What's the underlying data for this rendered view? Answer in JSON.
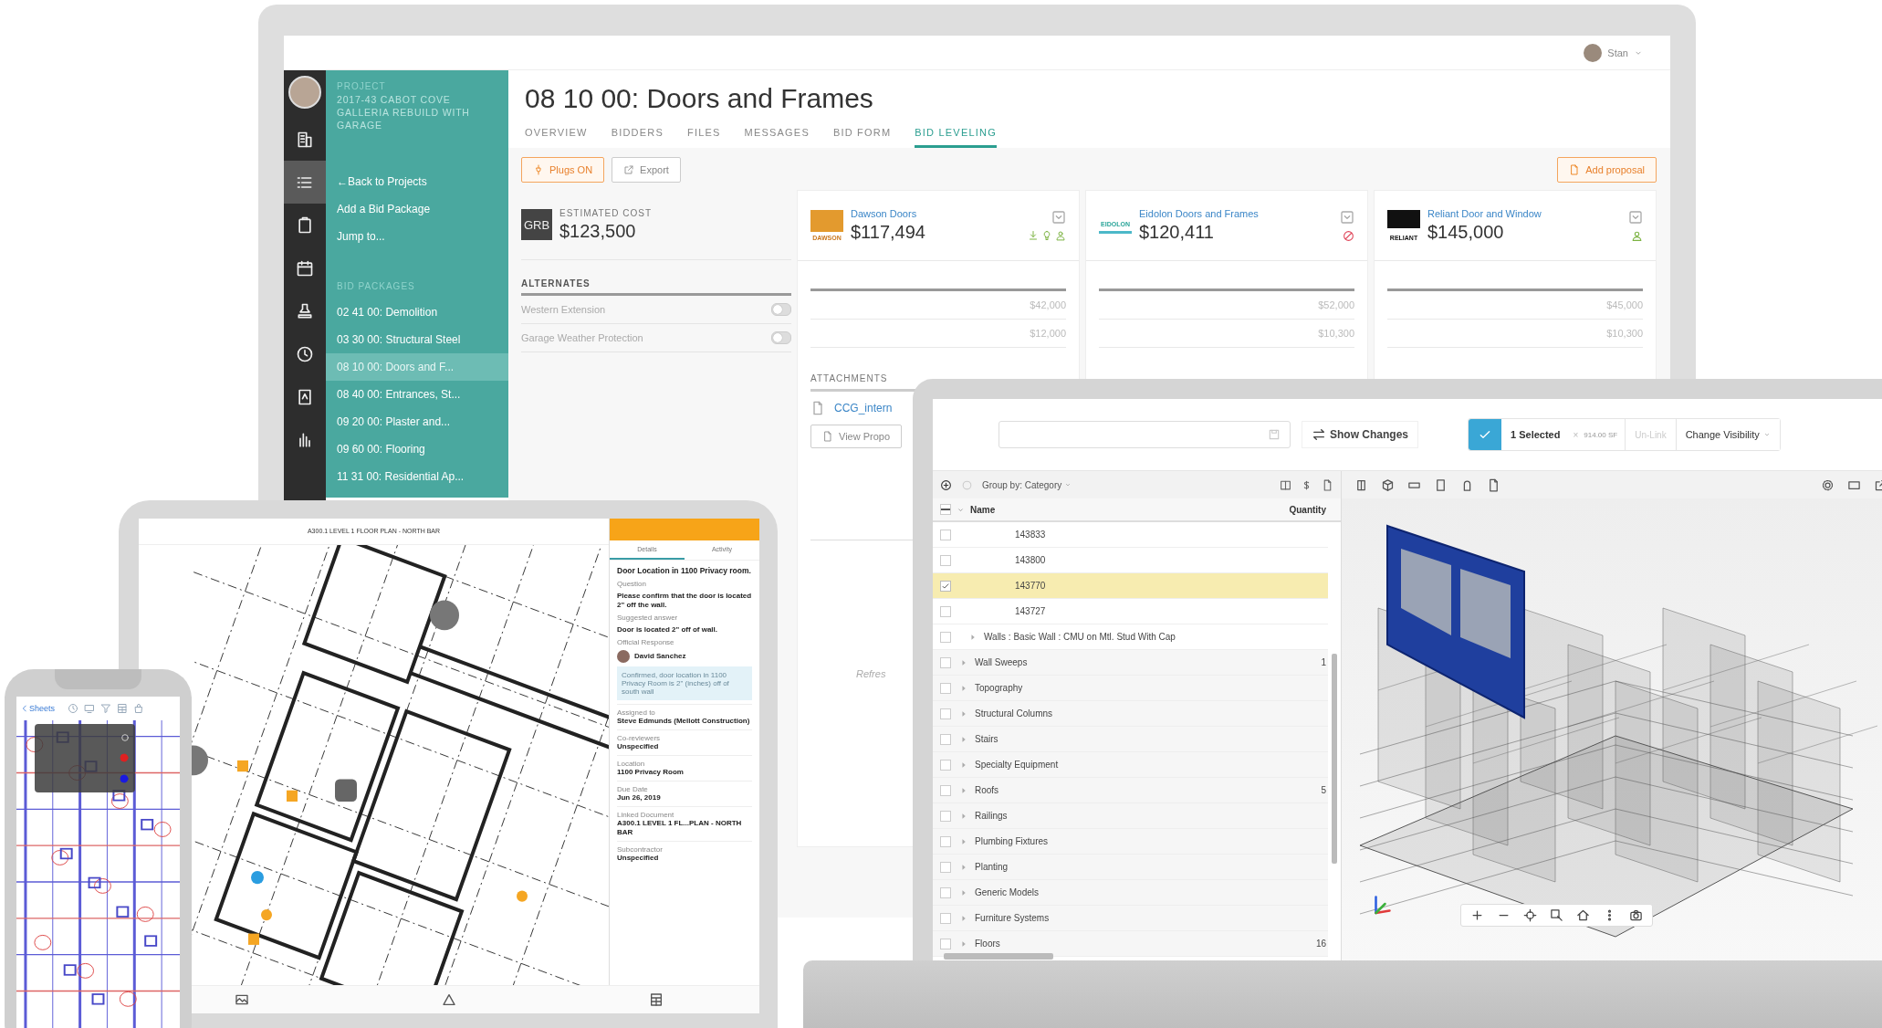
{
  "monitor": {
    "user": {
      "name": "Stan"
    },
    "rail": [
      {
        "kind": "building",
        "selected": false
      },
      {
        "kind": "list",
        "selected": true
      },
      {
        "kind": "clipboard",
        "selected": false
      },
      {
        "kind": "calendar",
        "selected": false
      },
      {
        "kind": "stamp",
        "selected": false
      },
      {
        "kind": "clock",
        "selected": false
      },
      {
        "kind": "book",
        "selected": false
      },
      {
        "kind": "chart",
        "selected": false
      }
    ],
    "sidebar": {
      "project_label": "PROJECT",
      "project_name": "2017-43 CABOT COVE GALLERIA REBUILD WITH GARAGE",
      "links": [
        "←Back to Projects",
        "Add a Bid Package",
        "Jump to..."
      ],
      "section_label": "BID PACKAGES",
      "packages": [
        {
          "label": "02 41 00: Demolition",
          "selected": false
        },
        {
          "label": "03 30 00: Structural Steel",
          "selected": false
        },
        {
          "label": "08 10 00: Doors and F...",
          "selected": true
        },
        {
          "label": "08 40 00: Entrances, St...",
          "selected": false
        },
        {
          "label": "09 20 00: Plaster and...",
          "selected": false
        },
        {
          "label": "09 60 00: Flooring",
          "selected": false
        },
        {
          "label": "11 31 00: Residential Ap...",
          "selected": false
        }
      ]
    },
    "page": {
      "title": "08 10 00: Doors and Frames",
      "tabs": [
        {
          "label": "OVERVIEW",
          "selected": false
        },
        {
          "label": "BIDDERS",
          "selected": false
        },
        {
          "label": "FILES",
          "selected": false
        },
        {
          "label": "MESSAGES",
          "selected": false
        },
        {
          "label": "BID FORM",
          "selected": false
        },
        {
          "label": "BID LEVELING",
          "selected": true
        }
      ],
      "actions": [
        {
          "kind": "plugs",
          "label": "Plugs ON"
        },
        {
          "kind": "export",
          "label": "Export"
        }
      ],
      "add_button": "Add proposal",
      "estimate": {
        "logo": "GRB",
        "label": "ESTIMATED COST",
        "amount": "$123,500"
      },
      "alternates": {
        "heading": "ALTERNATES",
        "rows": [
          {
            "label": "Western Extension",
            "on": false
          },
          {
            "label": "Garage Weather Protection",
            "on": false
          }
        ]
      },
      "bidders": [
        {
          "logo": "DAWSON",
          "name": "Dawson Doors",
          "amount": "$117,494",
          "kind": "submitted",
          "alternates": [
            "$42,000",
            "$12,000"
          ]
        },
        {
          "logo": "EIDOLON",
          "name": "Eidolon Doors and Frames",
          "amount": "$120,411",
          "kind": "declined",
          "alternates": [
            "$52,000",
            "$10,300"
          ]
        },
        {
          "logo": "RELIANT",
          "name": "Reliant Door and Window",
          "amount": "$145,000",
          "kind": "invited",
          "alternates": [
            "$45,000",
            "$10,300"
          ]
        }
      ],
      "attachments": {
        "heading": "ATTACHMENTS",
        "file": "CCG_intern",
        "button": "View Propo"
      },
      "refresh": "Refres"
    }
  },
  "laptop": {
    "show_changes": "Show Changes",
    "selection": {
      "count": "1 Selected",
      "clear": "×",
      "area": "914.00 SF",
      "unlink": "Un-Link",
      "unlink_disabled": true,
      "visibility": "Change Visibility"
    },
    "group_by": "Group by: Category",
    "select_all": {
      "partial": true
    },
    "columns": [
      "Name",
      "Quantity"
    ],
    "rows": [
      {
        "kind": "element",
        "name": "143833",
        "checked": false,
        "selected": false
      },
      {
        "kind": "element",
        "name": "143800",
        "checked": false,
        "selected": false
      },
      {
        "kind": "element",
        "name": "143770",
        "checked": true,
        "selected": true
      },
      {
        "kind": "element",
        "name": "143727",
        "checked": false,
        "selected": false
      },
      {
        "kind": "type",
        "name": "Walls : Basic Wall : CMU on Mtl. Stud With Cap",
        "checked": false,
        "selected": false
      },
      {
        "kind": "category",
        "name": "Wall Sweeps",
        "quantity": "1",
        "checked": false,
        "selected": false
      },
      {
        "kind": "category",
        "name": "Topography",
        "checked": false,
        "selected": false
      },
      {
        "kind": "category",
        "name": "Structural Columns",
        "checked": false,
        "selected": false
      },
      {
        "kind": "category",
        "name": "Stairs",
        "checked": false,
        "selected": false
      },
      {
        "kind": "category",
        "name": "Specialty Equipment",
        "checked": false,
        "selected": false
      },
      {
        "kind": "category",
        "name": "Roofs",
        "quantity": "5",
        "checked": false,
        "selected": false
      },
      {
        "kind": "category",
        "name": "Railings",
        "checked": false,
        "selected": false
      },
      {
        "kind": "category",
        "name": "Plumbing Fixtures",
        "checked": false,
        "selected": false
      },
      {
        "kind": "category",
        "name": "Planting",
        "checked": false,
        "selected": false
      },
      {
        "kind": "category",
        "name": "Generic Models",
        "checked": false,
        "selected": false
      },
      {
        "kind": "category",
        "name": "Furniture Systems",
        "checked": false,
        "selected": false
      },
      {
        "kind": "category",
        "name": "Floors",
        "quantity": "16",
        "checked": false,
        "selected": false
      }
    ]
  },
  "tablet": {
    "sheet_title": "A300.1 LEVEL 1 FLOOR PLAN - NORTH BAR",
    "tabs": [
      {
        "label": "Details",
        "selected": true
      },
      {
        "label": "Activity",
        "selected": false
      }
    ],
    "heading": "Door Location in 1100 Privacy room.",
    "question": {
      "label": "Question",
      "value": "Please confirm that the door is located 2\" off the wall."
    },
    "suggested": {
      "label": "Suggested answer",
      "value": "Door is located 2\" off of wall."
    },
    "response": {
      "label": "Official Response",
      "author": "David Sanchez",
      "text": "Confirmed, door location in 1100 Privacy Room is 2\" (inches) off of south wall"
    },
    "fields": [
      {
        "label": "Assigned to",
        "value": "Steve Edmunds (Mellott Construction)"
      },
      {
        "label": "Co-reviewers",
        "value": "Unspecified"
      },
      {
        "label": "Location",
        "value": "1100 Privacy Room"
      },
      {
        "label": "Due Date",
        "value": "Jun 26, 2019"
      },
      {
        "label": "Linked Document",
        "value": "A300.1 LEVEL 1 FL...PLAN - NORTH BAR"
      },
      {
        "label": "Subcontractor",
        "value": "Unspecified"
      }
    ]
  },
  "phone": {
    "back": "Sheets"
  }
}
